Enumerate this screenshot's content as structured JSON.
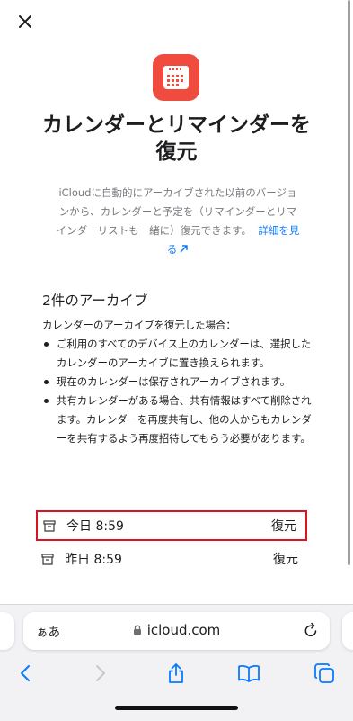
{
  "modal": {
    "title_line1": "カレンダーとリマインダーを",
    "title_line2": "復元",
    "description": "iCloudに自動的にアーカイブされた以前のバージョンから、カレンダーと予定を（リマインダーとリマインダーリストも一緒に）復元できます。",
    "learn_more_link": "詳細を見る",
    "section_title": "2件のアーカイブ",
    "note_intro": "カレンダーのアーカイブを復元した場合：",
    "bullets": [
      "ご利用のすべてのデバイス上のカレンダーは、選択したカレンダーのアーカイブに置き換えられます。",
      "現在のカレンダーは保存されアーカイブされます。",
      "共有カレンダーがある場合、共有情報はすべて削除されます。カレンダーを再度共有し、他の人からもカレンダーを共有するよう再度招待してもらう必要があります。"
    ],
    "archives": [
      {
        "label": "今日 8:59",
        "action": "復元"
      },
      {
        "label": "昨日 8:59",
        "action": "復元"
      }
    ]
  },
  "browser": {
    "text_size_button": "ぁあ",
    "url": "icloud.com"
  },
  "colors": {
    "app_icon": "#ef4b3f",
    "highlight_border": "#d9141f",
    "link": "#0a7aff",
    "toolbar_icon": "#0a7aff",
    "toolbar_icon_disabled": "#c7c7cc"
  },
  "icons": [
    "close-icon",
    "calendar-icon",
    "archive-box-icon",
    "lock-icon",
    "reload-icon",
    "back-icon",
    "forward-icon",
    "share-icon",
    "bookmarks-icon",
    "tabs-icon",
    "external-link-icon"
  ]
}
